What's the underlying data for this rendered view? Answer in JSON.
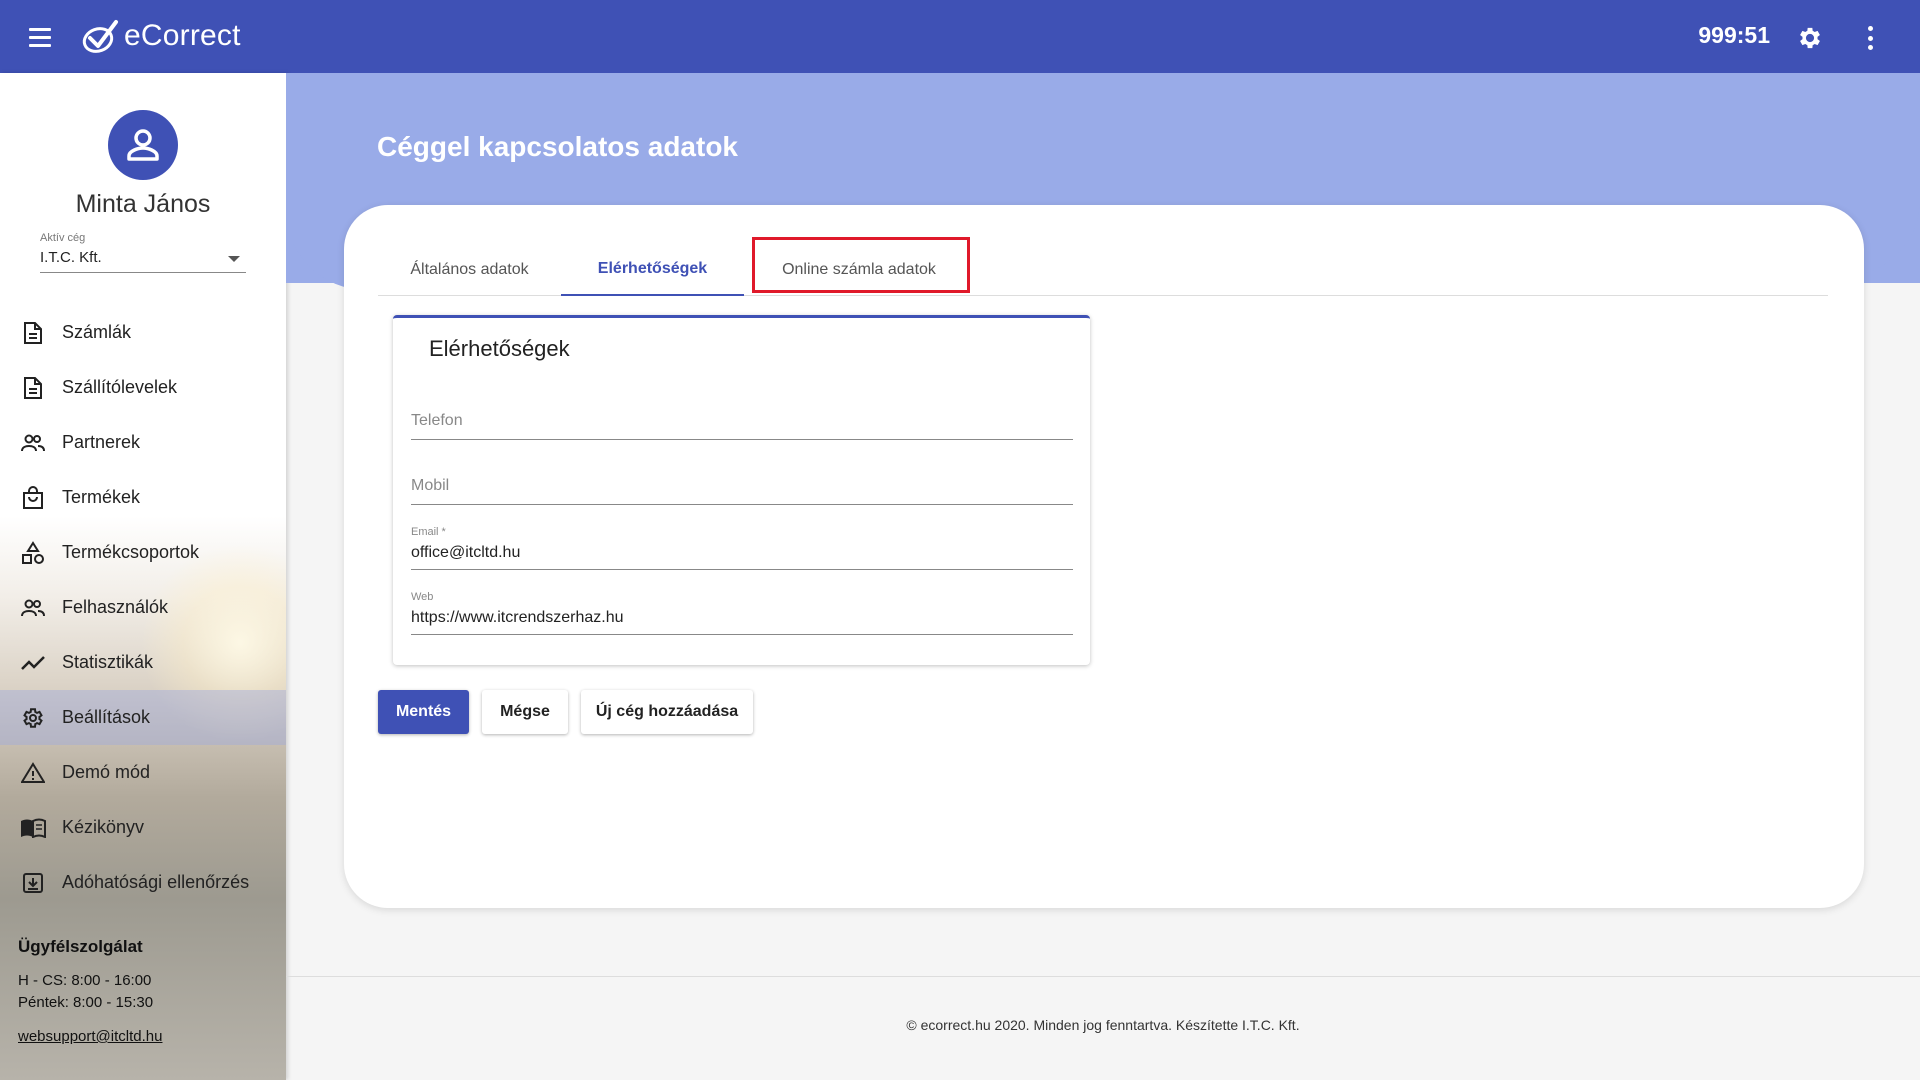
{
  "header": {
    "app_name": "eCorrect",
    "timer": "999:51",
    "menu_icon": "hamburger-menu-icon",
    "settings_icon": "gear-icon",
    "more_icon": "kebab-menu-icon",
    "brand_color": "#3f51b5"
  },
  "sidebar": {
    "user_name": "Minta János",
    "company_label": "Aktív cég",
    "company_value": "I.T.C. Kft.",
    "items": [
      {
        "label": "Számlák",
        "icon": "document-icon"
      },
      {
        "label": "Szállítólevelek",
        "icon": "document-icon"
      },
      {
        "label": "Partnerek",
        "icon": "people-icon"
      },
      {
        "label": "Termékek",
        "icon": "shopping-bag-icon"
      },
      {
        "label": "Termékcsoportok",
        "icon": "shapes-icon"
      },
      {
        "label": "Felhasználók",
        "icon": "people-icon"
      },
      {
        "label": "Statisztikák",
        "icon": "trend-line-icon"
      },
      {
        "label": "Beállítások",
        "icon": "gear-icon",
        "active": true
      },
      {
        "label": "Demó mód",
        "icon": "warning-icon"
      },
      {
        "label": "Kézikönyv",
        "icon": "book-icon"
      },
      {
        "label": "Adóhatósági ellenőrzés",
        "icon": "archive-download-icon"
      }
    ],
    "support": {
      "title": "Ügyfélszolgálat",
      "hours_1": "H - CS: 8:00 - 16:00",
      "hours_2": "Péntek: 8:00 - 15:30",
      "email": "websupport@itcltd.hu"
    }
  },
  "main": {
    "page_title": "Céggel kapcsolatos adatok",
    "tabs": [
      {
        "label": "Általános adatok"
      },
      {
        "label": "Elérhetőségek",
        "active": true
      },
      {
        "label": "Online számla adatok"
      }
    ],
    "section_title": "Elérhetőségek",
    "fields": {
      "phone_placeholder": "Telefon",
      "mobile_placeholder": "Mobil",
      "email_label": "Email *",
      "email_value": "office@itcltd.hu",
      "web_label": "Web",
      "web_value": "https://www.itcrendszerhaz.hu"
    },
    "buttons": {
      "save": "Mentés",
      "cancel": "Mégse",
      "add_company": "Új cég hozzáadása"
    }
  },
  "footer": {
    "text": "© ecorrect.hu 2020. Minden jog fenntartva. Készítette I.T.C. Kft."
  },
  "colors": {
    "hero": "#99abe8",
    "highlight": "#e0192a"
  }
}
